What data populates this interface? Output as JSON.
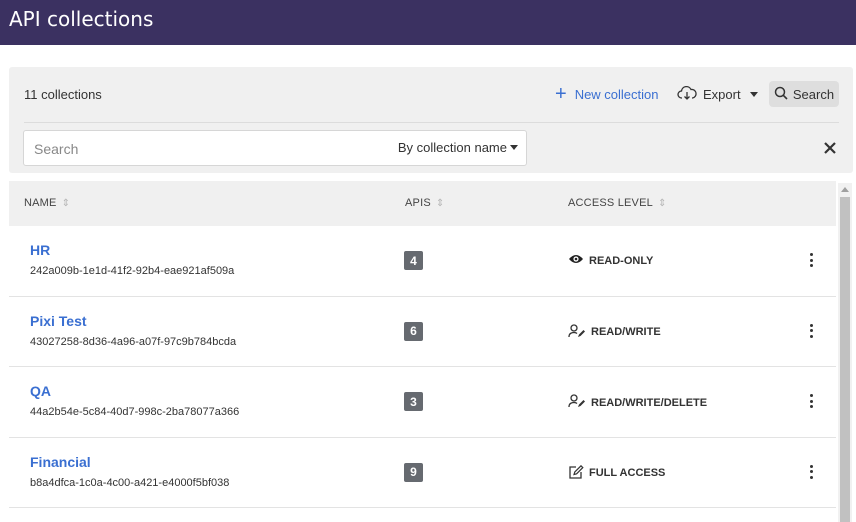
{
  "header": {
    "title": "API collections"
  },
  "toolbar": {
    "count_label": "11 collections",
    "new_label": "New collection",
    "export_label": "Export",
    "search_label": "Search"
  },
  "search": {
    "placeholder": "Search",
    "filter_label": "By collection name"
  },
  "table": {
    "columns": {
      "name": "NAME",
      "apis": "APIS",
      "access": "ACCESS LEVEL"
    },
    "rows": [
      {
        "name": "HR",
        "id": "242a009b-1e1d-41f2-92b4-eae921af509a",
        "apis": "4",
        "access": "READ-ONLY",
        "access_icon": "eye-icon"
      },
      {
        "name": "Pixi Test",
        "id": "43027258-8d36-4a96-a07f-97c9b784bcda",
        "apis": "6",
        "access": "READ/WRITE",
        "access_icon": "user-edit-icon"
      },
      {
        "name": "QA",
        "id": "44a2b54e-5c84-40d7-998c-2ba78077a366",
        "apis": "3",
        "access": "READ/WRITE/DELETE",
        "access_icon": "user-edit-icon"
      },
      {
        "name": "Financial",
        "id": "b8a4dfca-1c0a-4c00-a421-e4000f5bf038",
        "apis": "9",
        "access": "FULL ACCESS",
        "access_icon": "edit-square-icon"
      }
    ]
  },
  "colors": {
    "header_bg": "#3b3161",
    "accent": "#3a6fd1",
    "badge_bg": "#666a70"
  }
}
